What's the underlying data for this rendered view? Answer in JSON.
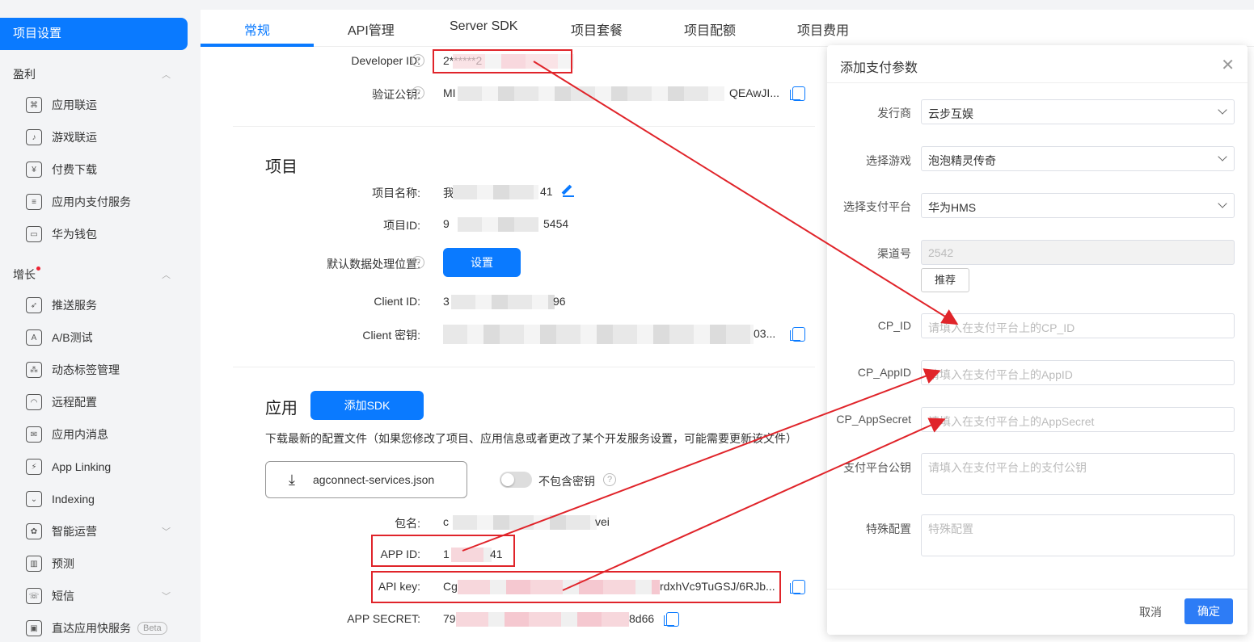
{
  "sidebar": {
    "active": "项目设置",
    "groups": [
      {
        "label": "盈利",
        "dot": false
      },
      {
        "label": "增长",
        "dot": true
      }
    ],
    "items": [
      {
        "label": "应用联运",
        "icon": "link-icon"
      },
      {
        "label": "游戏联运",
        "icon": "gamepad-icon"
      },
      {
        "label": "付费下载",
        "icon": "yen-icon"
      },
      {
        "label": "应用内支付服务",
        "icon": "receipt-icon"
      },
      {
        "label": "华为钱包",
        "icon": "wallet-icon"
      },
      {
        "label": "推送服务",
        "icon": "rocket-icon"
      },
      {
        "label": "A/B测试",
        "icon": "ab-icon"
      },
      {
        "label": "动态标签管理",
        "icon": "tags-icon"
      },
      {
        "label": "远程配置",
        "icon": "remote-icon"
      },
      {
        "label": "应用内消息",
        "icon": "message-icon"
      },
      {
        "label": "App Linking",
        "icon": "applink-icon"
      },
      {
        "label": "Indexing",
        "icon": "index-icon"
      },
      {
        "label": "智能运营",
        "icon": "smart-icon"
      },
      {
        "label": "预测",
        "icon": "predict-icon"
      },
      {
        "label": "短信",
        "icon": "sms-icon"
      },
      {
        "label": "直达应用快服务",
        "icon": "quickapp-icon",
        "badge": "Beta"
      }
    ]
  },
  "tabs": [
    "常规",
    "API管理",
    "Server SDK",
    "项目套餐",
    "项目配额",
    "项目费用"
  ],
  "developer": {
    "developer_id_label": "Developer ID:",
    "developer_id_value": "2******2",
    "pubkey_label": "验证公钥:",
    "pubkey_prefix": "MI",
    "pubkey_suffix": "QEAwJI..."
  },
  "project": {
    "title": "项目",
    "name_label": "项目名称:",
    "name_prefix": "我",
    "name_suffix": "41",
    "id_label": "项目ID:",
    "id_prefix": "9",
    "id_suffix": "5454",
    "location_label": "默认数据处理位置:",
    "location_button": "设置",
    "client_id_label": "Client ID:",
    "client_id_prefix": "3",
    "client_id_suffix": "96",
    "client_secret_label": "Client 密钥:",
    "client_secret_suffix": "03..."
  },
  "app": {
    "title": "应用",
    "add_sdk": "添加SDK",
    "note": "下载最新的配置文件（如果您修改了项目、应用信息或者更改了某个开发服务设置，可能需要更新该文件）",
    "config_file": "agconnect-services.json",
    "toggle_label": "不包含密钥",
    "package_label": "包名:",
    "package_prefix": "c",
    "package_suffix": "vei",
    "app_id_label": "APP ID:",
    "app_id_prefix": "1",
    "app_id_suffix": "41",
    "api_key_label": "API key:",
    "api_key_prefix": "Cg",
    "api_key_suffix": "rdxhVc9TuGSJ/6RJb...",
    "app_secret_label": "APP SECRET:",
    "app_secret_prefix": "79",
    "app_secret_suffix": "8d66"
  },
  "dialog": {
    "title": "添加支付参数",
    "publisher_label": "发行商",
    "publisher_value": "云步互娱",
    "game_label": "选择游戏",
    "game_value": "泡泡精灵传奇",
    "platform_label": "选择支付平台",
    "platform_value": "华为HMS",
    "channel_label": "渠道号",
    "channel_value": "2542",
    "recommend_button": "推荐",
    "cp_id_label": "CP_ID",
    "cp_id_placeholder": "请填入在支付平台上的CP_ID",
    "cp_appid_label": "CP_AppID",
    "cp_appid_placeholder": "请填入在支付平台上的AppID",
    "cp_appsecret_label": "CP_AppSecret",
    "cp_appsecret_placeholder": "请填入在支付平台上的AppSecret",
    "pubkey_label": "支付平台公钥",
    "pubkey_placeholder": "请填入在支付平台上的支付公钥",
    "special_label": "特殊配置",
    "special_placeholder": "特殊配置",
    "cancel": "取消",
    "ok": "确定"
  },
  "colors": {
    "accent": "#0a7aff",
    "annotation": "#e0242a"
  }
}
